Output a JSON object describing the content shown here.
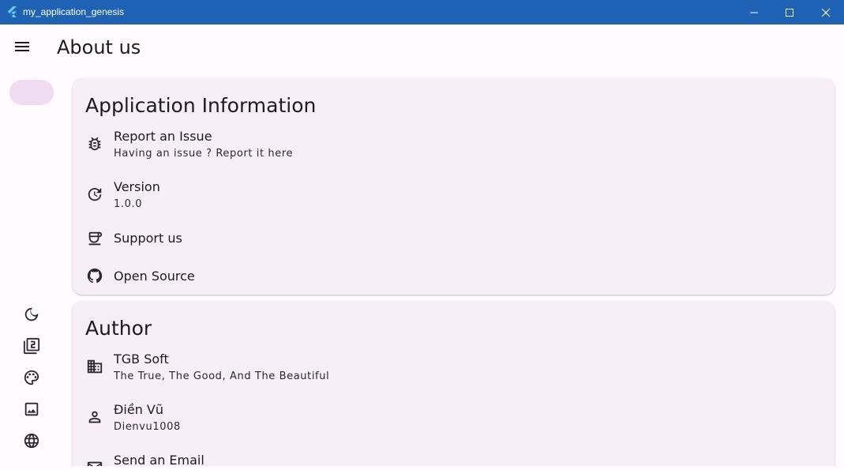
{
  "window": {
    "title": "my_application_genesis",
    "controls": [
      "minimize-icon",
      "maximize-icon",
      "close-icon"
    ]
  },
  "appbar": {
    "menu_icon": "menu-icon",
    "title": "About us"
  },
  "rail": {
    "selected_indicator_color": "#efdbf2",
    "icons": [
      "dark-mode-icon",
      "filter-2-icon",
      "palette-icon",
      "image-icon",
      "language-icon"
    ]
  },
  "sections": {
    "app_info": {
      "title": "Application Information",
      "items": [
        {
          "icon": "bug-icon",
          "title": "Report an Issue",
          "subtitle": "Having an issue ? Report it here"
        },
        {
          "icon": "update-icon",
          "title": "Version",
          "subtitle": "1.0.0"
        },
        {
          "icon": "coffee-icon",
          "title": "Support us"
        },
        {
          "icon": "github-icon",
          "title": "Open Source"
        }
      ]
    },
    "author": {
      "title": "Author",
      "items": [
        {
          "icon": "business-icon",
          "title": "TGB Soft",
          "subtitle": "The True, The Good, And The Beautiful"
        },
        {
          "icon": "person-icon",
          "title": "Điền Vũ",
          "subtitle": "Dienvu1008"
        },
        {
          "icon": "email-icon",
          "title": "Send an Email"
        }
      ]
    }
  },
  "colors": {
    "titlebar": "#1f62b4",
    "background": "#fffbfe",
    "card": "#f8eef6",
    "text": "#1d1b20"
  }
}
